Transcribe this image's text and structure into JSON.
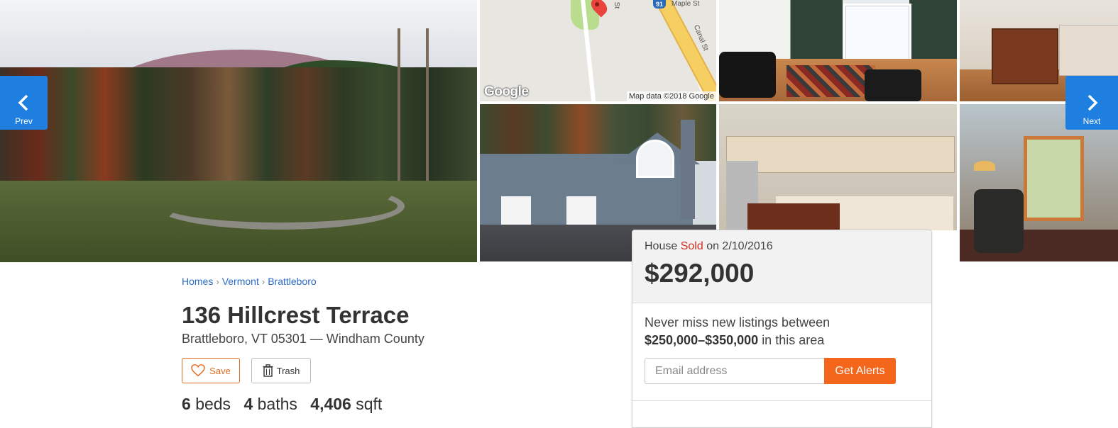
{
  "gallery": {
    "prev_label": "Prev",
    "next_label": "Next",
    "map": {
      "logo": "Google",
      "attribution": "Map data ©2018 Google",
      "street1": "Maple St",
      "street2": "Canal St",
      "street3": "St",
      "route": "91"
    }
  },
  "breadcrumb": [
    "Homes",
    "Vermont",
    "Brattleboro"
  ],
  "listing": {
    "address": "136 Hillcrest Terrace",
    "cityline": "Brattleboro, VT 05301 — Windham County",
    "save_label": "Save",
    "trash_label": "Trash",
    "beds": "6",
    "beds_label": "beds",
    "baths": "4",
    "baths_label": "baths",
    "sqft": "4,406",
    "sqft_label": "sqft"
  },
  "sold_card": {
    "type": "House",
    "status": "Sold",
    "date_text": "on 2/10/2016",
    "price": "$292,000",
    "alert_prefix": "Never miss new listings between",
    "alert_range": "$250,000–$350,000",
    "alert_suffix": "in this area",
    "email_placeholder": "Email address",
    "button_label": "Get Alerts"
  },
  "colors": {
    "accent_blue": "#1f7fe0",
    "link_blue": "#2b6bc4",
    "orange": "#f4661b",
    "sold_red": "#d32f1f"
  },
  "icons": [
    "chevron-left-icon",
    "chevron-right-icon",
    "heart-icon",
    "trash-icon",
    "map-pin-icon",
    "route-shield-icon"
  ]
}
